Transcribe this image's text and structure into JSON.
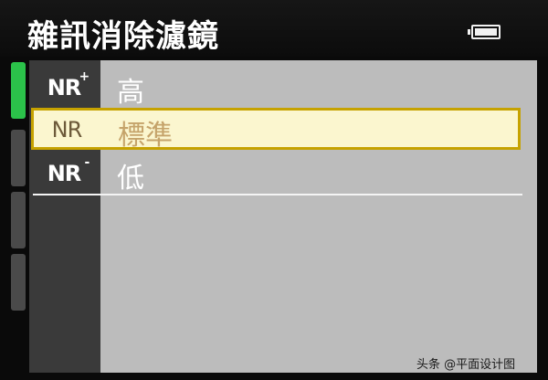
{
  "header": {
    "title": "雜訊消除濾鏡",
    "battery_icon": "battery-icon"
  },
  "menu": {
    "items": [
      {
        "icon": "nr-high-icon",
        "icon_text": "NR",
        "icon_sup": "+",
        "label": "高"
      },
      {
        "icon": "nr-standard-icon",
        "icon_text": "NR",
        "icon_sup": "",
        "label": "標準"
      },
      {
        "icon": "nr-low-icon",
        "icon_text": "NR",
        "icon_sup": "-",
        "label": "低"
      }
    ],
    "selected_index": 1
  },
  "tabs": {
    "count": 4,
    "active_index": 0,
    "active_color": "#2bc24a"
  },
  "colors": {
    "panel": "#bcbcbc",
    "selected_bg": "#fbf6cf",
    "selected_border": "#c6a200"
  },
  "watermark": "头条 @平面设计图"
}
